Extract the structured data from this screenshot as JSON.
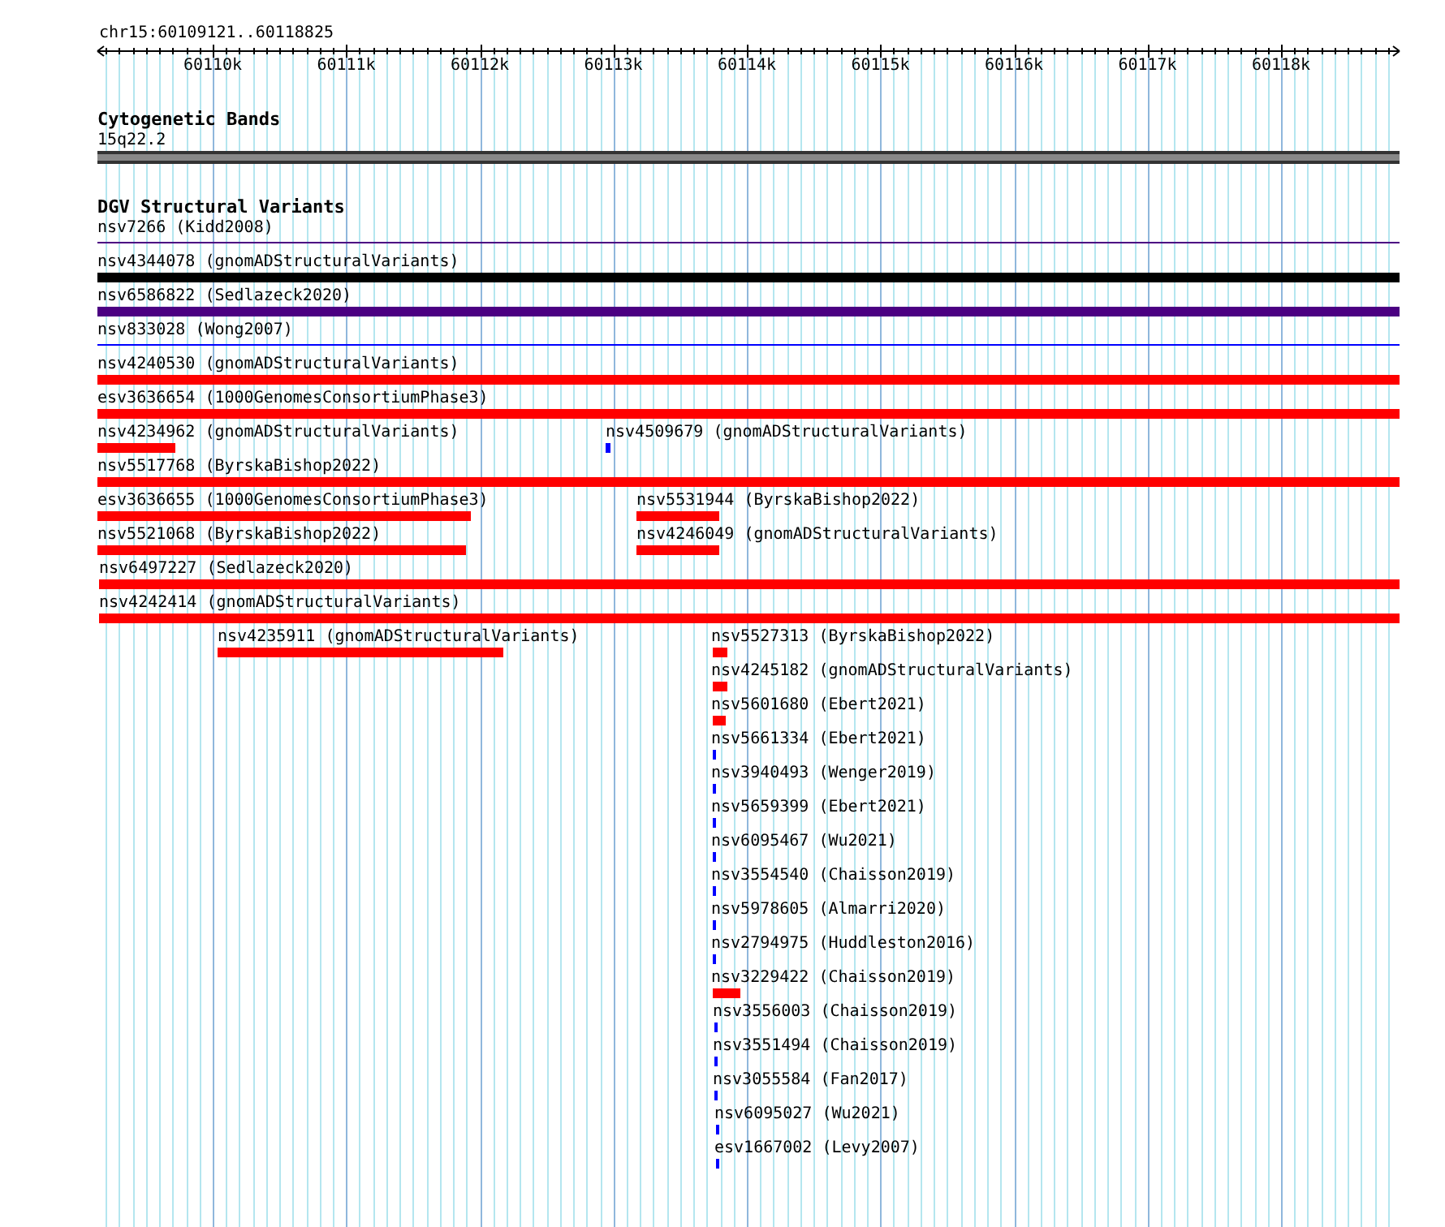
{
  "location": "chr15:60109121..60118825",
  "ruler": {
    "ticks": [
      "60110k",
      "60111k",
      "60112k",
      "60113k",
      "60114k",
      "60115k",
      "60116k",
      "60117k",
      "60118k"
    ]
  },
  "cytobands": {
    "title": "Cytogenetic Bands",
    "features": [
      {
        "label": "15q22.2"
      }
    ]
  },
  "dgv": {
    "title": "DGV Structural Variants",
    "features": [
      {
        "label": "nsv7266 (Kidd2008)",
        "kind": "line",
        "color": "#4b0082"
      },
      {
        "label": "nsv4344078 (gnomADStructuralVariants)",
        "kind": "bar",
        "color": "#000000"
      },
      {
        "label": "nsv6586822 (Sedlazeck2020)",
        "kind": "bar",
        "color": "#4b0082"
      },
      {
        "label": "nsv833028 (Wong2007)",
        "kind": "line",
        "color": "#0000ff"
      },
      {
        "label": "nsv4240530 (gnomADStructuralVariants)",
        "kind": "bar",
        "color": "#ff0000"
      },
      {
        "label": "esv3636654 (1000GenomesConsortiumPhase3)",
        "kind": "bar",
        "color": "#ff0000"
      },
      {
        "label": "nsv4234962 (gnomADStructuralVariants)",
        "kind": "bar",
        "color": "#ff0000"
      },
      {
        "label": "nsv4509679 (gnomADStructuralVariants)",
        "kind": "bar",
        "color": "#0000ff"
      },
      {
        "label": "nsv5517768 (ByrskaBishop2022)",
        "kind": "bar",
        "color": "#ff0000"
      },
      {
        "label": "esv3636655 (1000GenomesConsortiumPhase3)",
        "kind": "bar",
        "color": "#ff0000"
      },
      {
        "label": "nsv5531944 (ByrskaBishop2022)",
        "kind": "bar",
        "color": "#ff0000"
      },
      {
        "label": "nsv5521068 (ByrskaBishop2022)",
        "kind": "bar",
        "color": "#ff0000"
      },
      {
        "label": "nsv4246049 (gnomADStructuralVariants)",
        "kind": "bar",
        "color": "#ff0000"
      },
      {
        "label": "nsv6497227 (Sedlazeck2020)",
        "kind": "bar",
        "color": "#ff0000"
      },
      {
        "label": "nsv4242414 (gnomADStructuralVariants)",
        "kind": "bar",
        "color": "#ff0000"
      },
      {
        "label": "nsv4235911 (gnomADStructuralVariants)",
        "kind": "bar",
        "color": "#ff0000"
      },
      {
        "label": "nsv5527313 (ByrskaBishop2022)",
        "kind": "bar",
        "color": "#ff0000"
      },
      {
        "label": "nsv4245182 (gnomADStructuralVariants)",
        "kind": "bar",
        "color": "#ff0000"
      },
      {
        "label": "nsv5601680 (Ebert2021)",
        "kind": "bar",
        "color": "#ff0000"
      },
      {
        "label": "nsv5661334 (Ebert2021)",
        "kind": "bar",
        "color": "#0000ff"
      },
      {
        "label": "nsv3940493 (Wenger2019)",
        "kind": "bar",
        "color": "#0000ff"
      },
      {
        "label": "nsv5659399 (Ebert2021)",
        "kind": "bar",
        "color": "#0000ff"
      },
      {
        "label": "nsv6095467 (Wu2021)",
        "kind": "bar",
        "color": "#0000ff"
      },
      {
        "label": "nsv3554540 (Chaisson2019)",
        "kind": "bar",
        "color": "#0000ff"
      },
      {
        "label": "nsv5978605 (Almarri2020)",
        "kind": "bar",
        "color": "#0000ff"
      },
      {
        "label": "nsv2794975 (Huddleston2016)",
        "kind": "bar",
        "color": "#0000ff"
      },
      {
        "label": "nsv3229422 (Chaisson2019)",
        "kind": "bar",
        "color": "#ff0000"
      },
      {
        "label": "nsv3556003 (Chaisson2019)",
        "kind": "bar",
        "color": "#0000ff"
      },
      {
        "label": "nsv3551494 (Chaisson2019)",
        "kind": "bar",
        "color": "#0000ff"
      },
      {
        "label": "nsv3055584 (Fan2017)",
        "kind": "bar",
        "color": "#0000ff"
      },
      {
        "label": "nsv6095027 (Wu2021)",
        "kind": "bar",
        "color": "#0000ff"
      },
      {
        "label": "esv1667002 (Levy2007)",
        "kind": "bar",
        "color": "#0000ff"
      }
    ]
  }
}
